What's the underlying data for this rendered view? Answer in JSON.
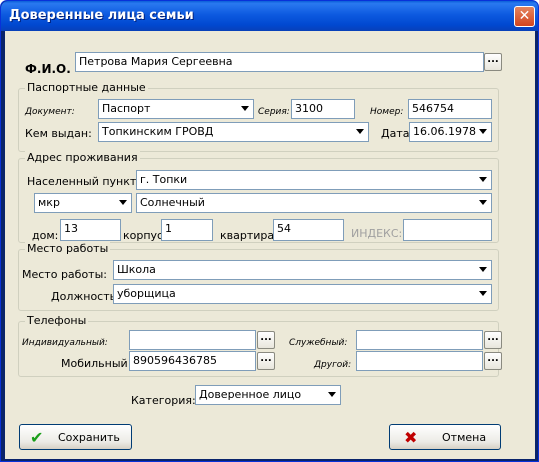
{
  "window": {
    "title": "Доверенные лица семьи"
  },
  "fio": {
    "label": "Ф.И.О.",
    "value": "Петрова Мария Сергеевна"
  },
  "passport": {
    "legend": "Паспортные данные",
    "document_label": "Документ:",
    "document_value": "Паспорт",
    "series_label": "Серия:",
    "series_value": "3100",
    "number_label": "Номер:",
    "number_value": "546754",
    "issued_label": "Кем выдан:",
    "issued_value": "Топкинским ГРОВД",
    "date_label": "Дата:",
    "date_value": "16.06.1978"
  },
  "address": {
    "legend": "Адрес проживания",
    "settlement_label": "Населенный пункт:",
    "settlement_value": "г. Топки",
    "district_type": "мкр",
    "district_value": "Солнечный",
    "house_label": "дом:",
    "house_value": "13",
    "building_label": "корпус:",
    "building_value": "1",
    "apartment_label": "квартира:",
    "apartment_value": "54",
    "index_label": "ИНДЕКС:",
    "index_value": ""
  },
  "work": {
    "legend": "Место работы",
    "place_label": "Место работы:",
    "place_value": "Школа",
    "position_label": "Должность:",
    "position_value": "уборщица"
  },
  "phones": {
    "legend": "Телефоны",
    "individual_label": "Индивидуальный:",
    "individual_value": "",
    "work_label": "Служебный:",
    "work_value": "",
    "mobile_label": "Мобильный:",
    "mobile_value": "890596436785",
    "other_label": "Другой:",
    "other_value": ""
  },
  "category": {
    "label": "Категория:",
    "value": "Доверенное лицо"
  },
  "buttons": {
    "save": "Сохранить",
    "cancel": "Отмена"
  },
  "ellipsis": "...",
  "icons": {
    "close": "close-icon",
    "check": "check-icon",
    "cross": "cross-icon",
    "dropdown": "chevron-down-icon"
  },
  "colors": {
    "title_bar": "#0a5fd8",
    "dialog_bg": "#ece9d8",
    "close": "#d2441e",
    "check": "#1a9e1a",
    "cross": "#c00000"
  }
}
